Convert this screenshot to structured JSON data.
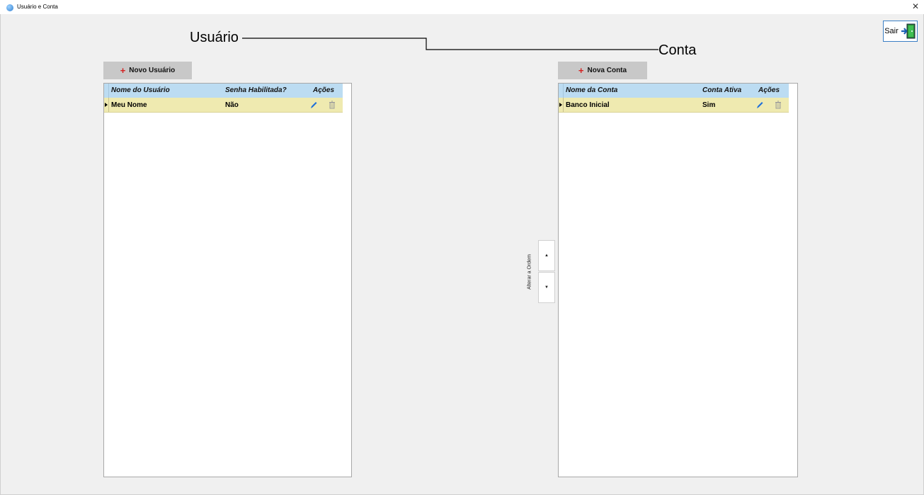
{
  "window": {
    "title": "Usuário e Conta",
    "close_glyph": "✕",
    "icon": "app-globe-icon"
  },
  "toolbar": {
    "exit_label": "Sair",
    "exit_icon": "exit-door-icon"
  },
  "section_labels": {
    "usuario": "Usuário",
    "conta": "Conta"
  },
  "users": {
    "add_button": {
      "plus": "+",
      "label": "Novo Usuário"
    },
    "columns": [
      "Nome do Usuário",
      "Senha Habilitada?",
      "Ações"
    ],
    "rows": [
      {
        "name": "Meu Nome",
        "password_enabled": "Não"
      }
    ]
  },
  "accounts": {
    "add_button": {
      "plus": "+",
      "label": "Nova Conta"
    },
    "columns": [
      "Nome da Conta",
      "Conta Ativa",
      "Ações"
    ],
    "rows": [
      {
        "name": "Banco Inicial",
        "active": "Sim"
      }
    ]
  },
  "order_control": {
    "label": "Alterar a Ordem",
    "up_glyph": "▲",
    "down_glyph": "▼"
  },
  "colors": {
    "header_bg": "#bcdcf2",
    "selected_row_bg": "#efeab0",
    "add_button_bg": "#c8c8c8",
    "plus_red": "#d42020",
    "edit_blue": "#1e6fd9"
  }
}
